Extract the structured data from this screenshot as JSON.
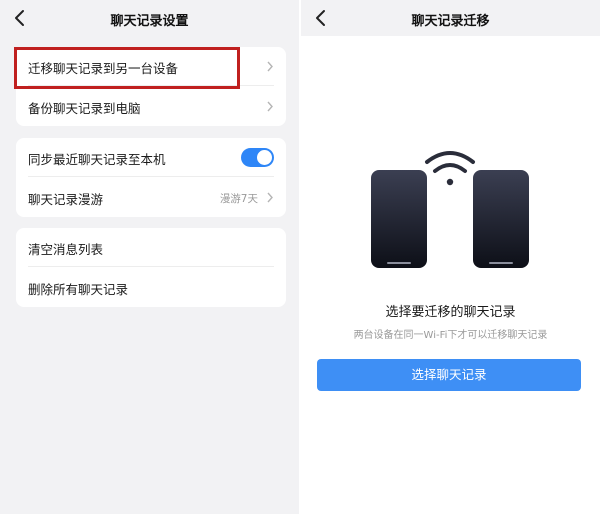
{
  "left": {
    "title": "聊天记录设置",
    "group1": [
      {
        "label": "迁移聊天记录到另一台设备"
      },
      {
        "label": "备份聊天记录到电脑"
      }
    ],
    "group2": {
      "sync": {
        "label": "同步最近聊天记录至本机",
        "toggle_on": true
      },
      "roam": {
        "label": "聊天记录漫游",
        "value": "漫游7天"
      }
    },
    "group3": [
      {
        "label": "清空消息列表"
      },
      {
        "label": "删除所有聊天记录"
      }
    ]
  },
  "right": {
    "title": "聊天记录迁移",
    "heading": "选择要迁移的聊天记录",
    "subtitle": "两台设备在同一Wi-Fi下才可以迁移聊天记录",
    "button_label": "选择聊天记录"
  },
  "colors": {
    "accent": "#3e8ff5",
    "highlight": "#c0201f",
    "background": "#f2f2f4"
  },
  "icons": [
    "back-arrow-icon",
    "chevron-right-icon",
    "toggle-switch",
    "wifi-icon",
    "phone-icon"
  ]
}
